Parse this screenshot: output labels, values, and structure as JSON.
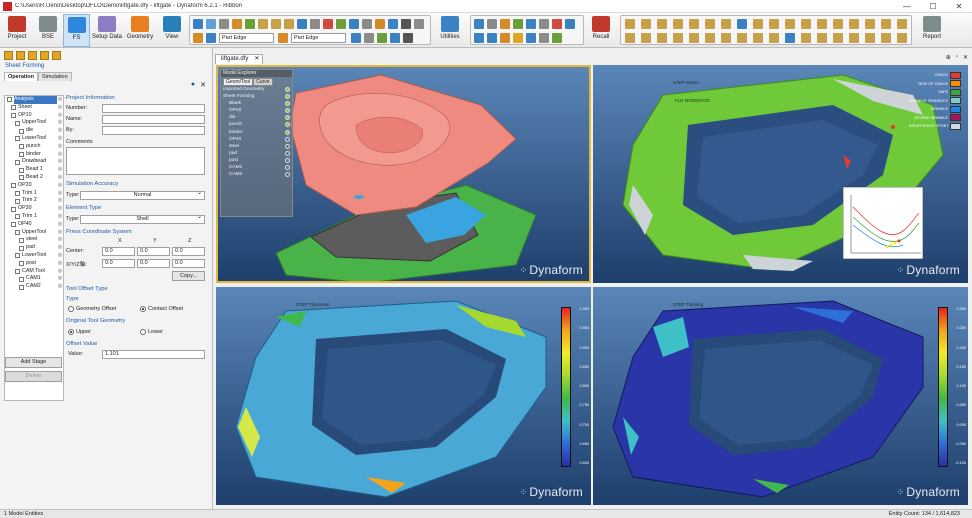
{
  "window": {
    "title": "C:\\Users\\R.Ueno\\Desktop\\DFLO\\Demo\\liftgate.dfy - liftgate - Dynaform 6.2.1 - Ribbon",
    "minimize": "—",
    "maximize": "☐",
    "close": "✕"
  },
  "ribbon": {
    "buttons": [
      {
        "label": "Project",
        "color": "#c0392b"
      },
      {
        "label": "BSE",
        "color": "#7f8c8d"
      },
      {
        "label": "FS",
        "color": "#2e86de"
      },
      {
        "label": "Setup Data",
        "color": "#8e7cc3"
      },
      {
        "label": "Geometry",
        "color": "#e67e22"
      },
      {
        "label": "View",
        "color": "#2980b9"
      }
    ],
    "part_combo_1": "Part Edge",
    "part_combo_2": "Part Edge",
    "utilities_label": "Utilities",
    "recall_label": "Recall",
    "report_label": "Report"
  },
  "left_panel": {
    "header": "Sheet Forming",
    "tabs": [
      "Operation",
      "Simulation"
    ],
    "close_icon": "✕",
    "tree": [
      {
        "label": "Analysis",
        "sel": true,
        "indent": 0
      },
      {
        "label": "Sheet",
        "indent": 1
      },
      {
        "label": "OP10",
        "indent": 1
      },
      {
        "label": "UpperTool",
        "indent": 2
      },
      {
        "label": "die",
        "indent": 3
      },
      {
        "label": "LowerTool",
        "indent": 2
      },
      {
        "label": "punch",
        "indent": 3
      },
      {
        "label": "binder",
        "indent": 3
      },
      {
        "label": "Drawbead",
        "indent": 2
      },
      {
        "label": "Bead 1",
        "indent": 3
      },
      {
        "label": "Bead 2",
        "indent": 3
      },
      {
        "label": "OP20",
        "indent": 1
      },
      {
        "label": "Trim 1",
        "indent": 2
      },
      {
        "label": "Trim 2",
        "indent": 2
      },
      {
        "label": "OP30",
        "indent": 1
      },
      {
        "label": "Trim 1",
        "indent": 2
      },
      {
        "label": "OP40",
        "indent": 1
      },
      {
        "label": "UpperTool",
        "indent": 2
      },
      {
        "label": "steel",
        "indent": 3
      },
      {
        "label": "pad",
        "indent": 3
      },
      {
        "label": "LowerTool",
        "indent": 2
      },
      {
        "label": "post",
        "indent": 3
      },
      {
        "label": "CAM Tool",
        "indent": 2
      },
      {
        "label": "CAM1",
        "indent": 3
      },
      {
        "label": "CAM2",
        "indent": 3
      }
    ],
    "project_info": "Project Information",
    "number_label": "Number:",
    "name_label": "Name:",
    "by_label": "By:",
    "comments_label": "Comments",
    "sim_accuracy": "Simulation Accuracy",
    "type_label": "Type:",
    "accuracy_value": "Normal",
    "element_type": "Element Type",
    "element_value": "Shell",
    "press_coord": "Press Coordinate System",
    "axis_x": "X",
    "axis_y": "Y",
    "axis_z": "Z",
    "center_label": "Center:",
    "axis_row_label": "X/Y/Z軸:",
    "coord": {
      "cx": "0.0",
      "cy": "0.0",
      "cz": "0.0",
      "ax": "0.0",
      "ay": "0.0",
      "az": "0.0"
    },
    "copy_button": "Copy...",
    "tool_offset_type": "Tool Offset Type",
    "type_head": "Type",
    "geometry_offset": "Geometry Offset",
    "contact_offset": "Contact Offset",
    "orig_tool_geom": "Original Tool Geometry",
    "upper": "Upper",
    "lower": "Lower",
    "offset_value": "Offset Value",
    "value_label": "Value:",
    "value": "1.101",
    "add_stage": "Add Stage",
    "delete": "Delete"
  },
  "doc_tab": "liftgate.dfy",
  "viewports": {
    "tl_overlay_title": "Model Explorer",
    "tl_overlay_tabs": [
      "Geom/Tool",
      "Curve"
    ],
    "tl_overlay_items": [
      "Imported Geometry",
      "Sheet Forming",
      "Blank",
      "OP10",
      "die",
      "punch",
      "binder",
      "OP40",
      "steel",
      "pad",
      "post",
      "CAM1",
      "CAM2"
    ],
    "tr_title": "STEP  Stress",
    "tr_sub": "FLD  MODERATE",
    "legend": [
      "CRACK",
      "RISK OF CRACK",
      "SAFE",
      "WRINKLE TENDENCY",
      "WRINKLE",
      "SEVERE WRINKLE",
      "INSUFFICIENT STRETCH"
    ],
    "legend_colors": [
      "#e53935",
      "#fb8c00",
      "#43a047",
      "#80cbc4",
      "#1e88e5",
      "#ad1457",
      "#cfd8dc"
    ],
    "bl_title": "STEP  Thickness",
    "br_title": "STEP  Thinning",
    "bl_ticks": [
      "1.000",
      "0.950",
      "0.900",
      "0.850",
      "0.800",
      "0.750",
      "0.700",
      "0.650",
      "0.600"
    ],
    "br_ticks": [
      "0.300",
      "0.250",
      "0.200",
      "0.150",
      "0.100",
      "0.050",
      "0.000",
      "-0.050",
      "-0.100"
    ],
    "brand": "Dynaform"
  },
  "status": {
    "left": "1 Model Entities",
    "right": "Entity Count: 134 / 1,614,823"
  }
}
